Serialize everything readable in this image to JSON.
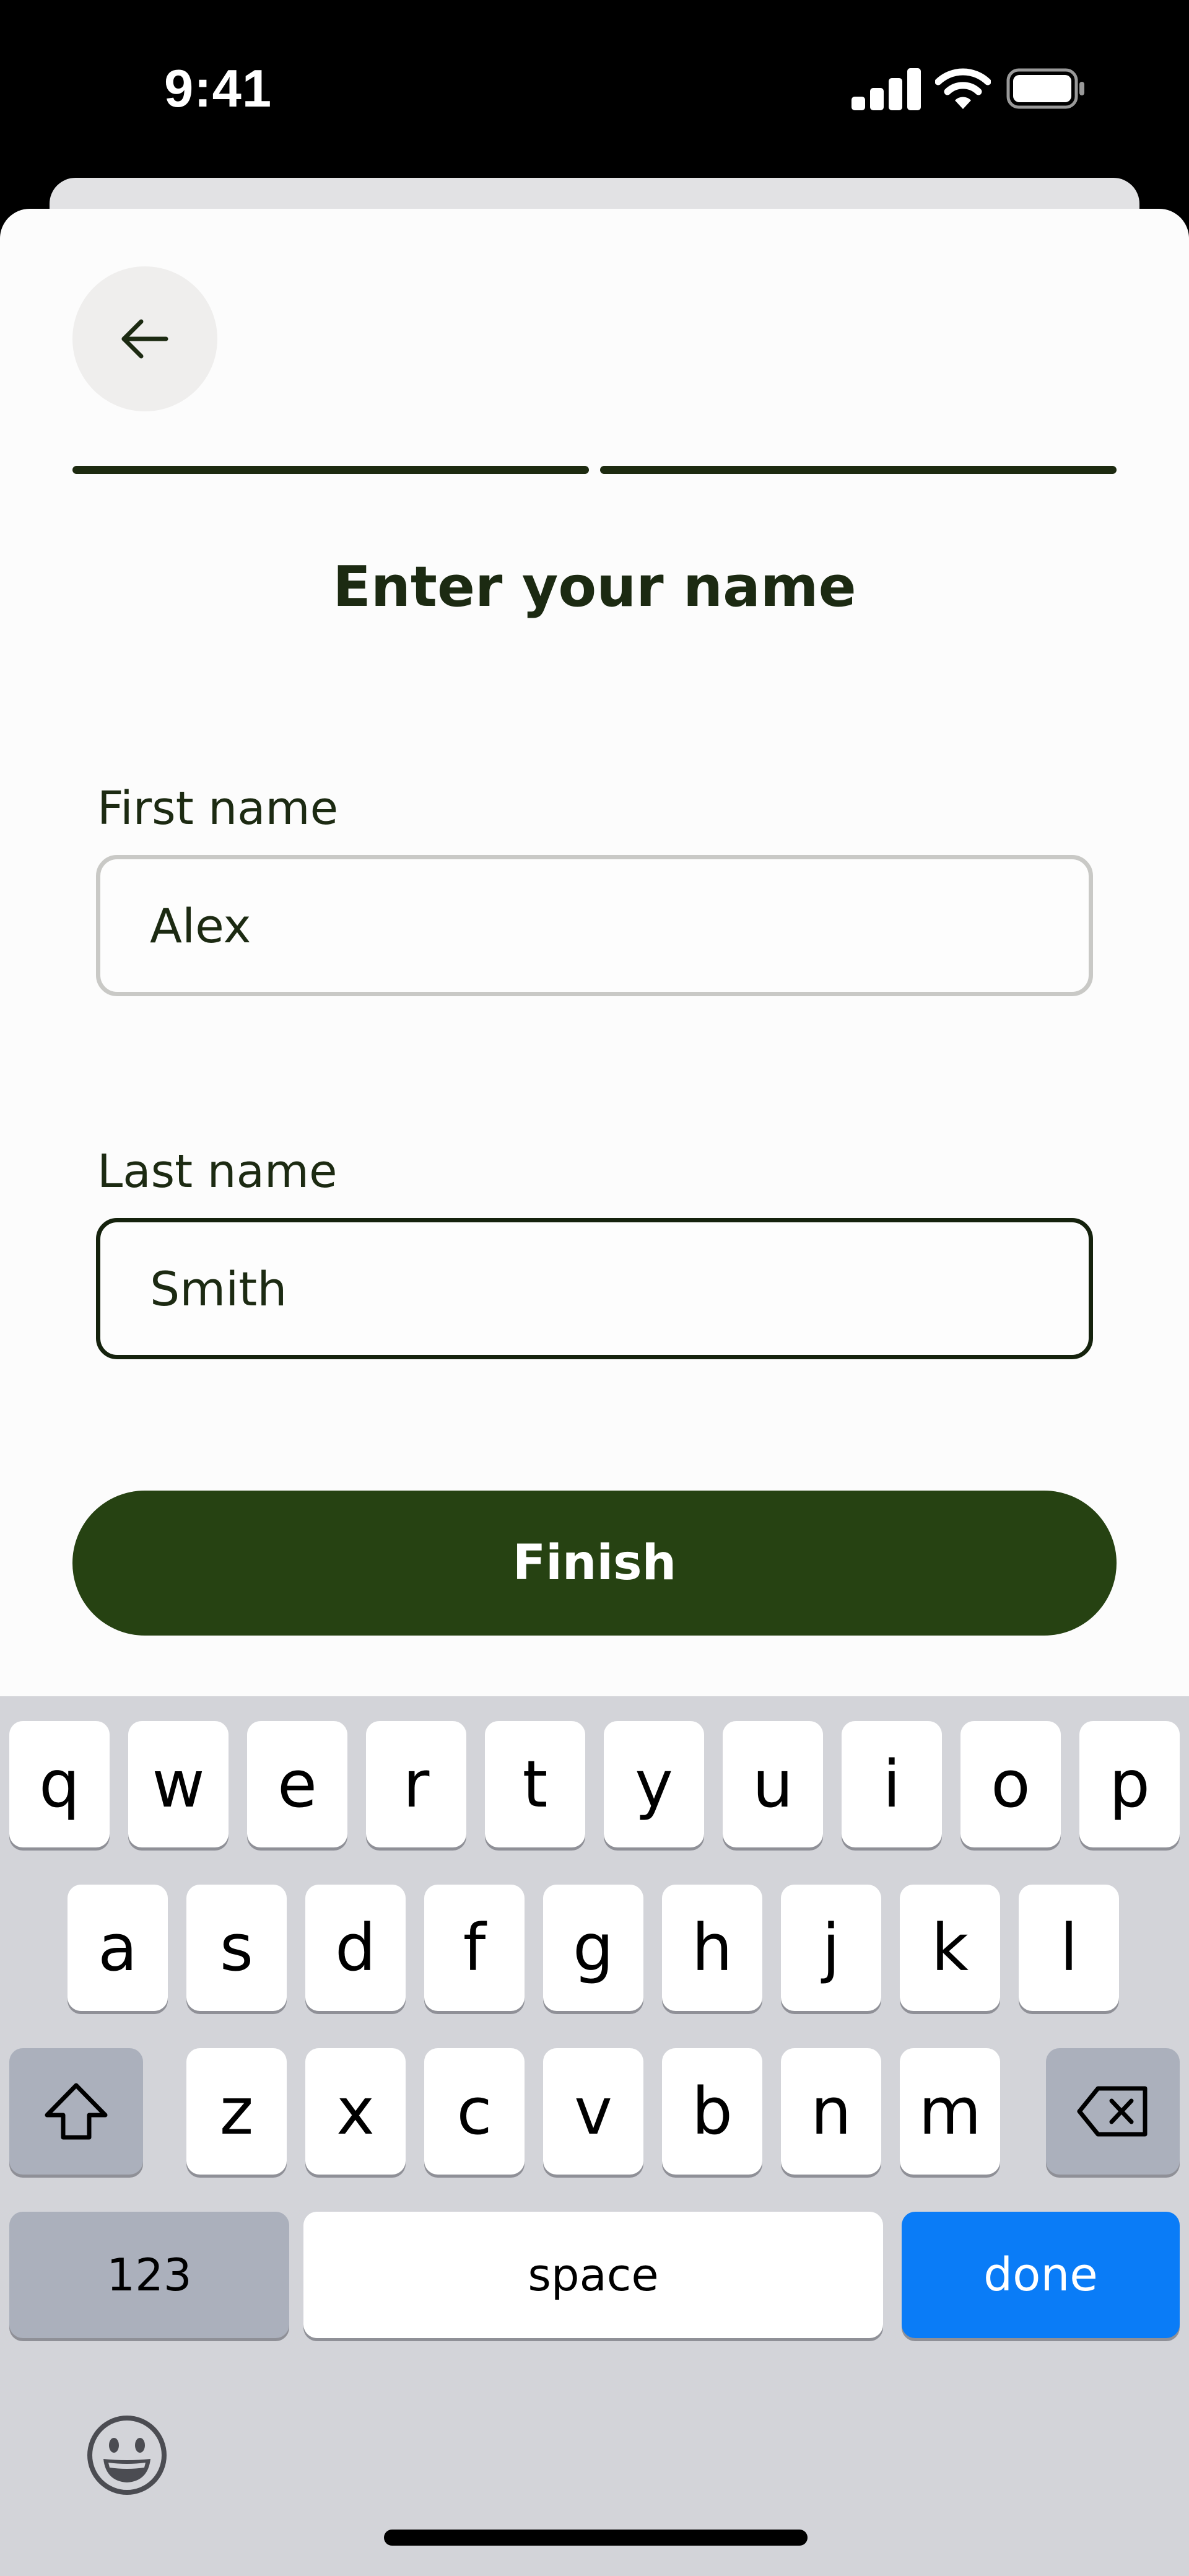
{
  "status_bar": {
    "time": "9:41"
  },
  "header": {
    "back_icon": "arrow-left-icon",
    "progress_steps_total": 2,
    "progress_steps_done": 2
  },
  "title": "Enter your name",
  "form": {
    "first_name": {
      "label": "First name",
      "value": "Alex"
    },
    "last_name": {
      "label": "Last name",
      "value": "Smith"
    }
  },
  "finish_label": "Finish",
  "keyboard": {
    "row1": [
      "q",
      "w",
      "e",
      "r",
      "t",
      "y",
      "u",
      "i",
      "o",
      "p"
    ],
    "row2": [
      "a",
      "s",
      "d",
      "f",
      "g",
      "h",
      "j",
      "k",
      "l"
    ],
    "row3": [
      "z",
      "x",
      "c",
      "v",
      "b",
      "n",
      "m"
    ],
    "numbers_label": "123",
    "space_label": "space",
    "done_label": "done"
  },
  "colors": {
    "brand_dark_green": "#264212",
    "done_key_blue": "#0a7cf7"
  }
}
